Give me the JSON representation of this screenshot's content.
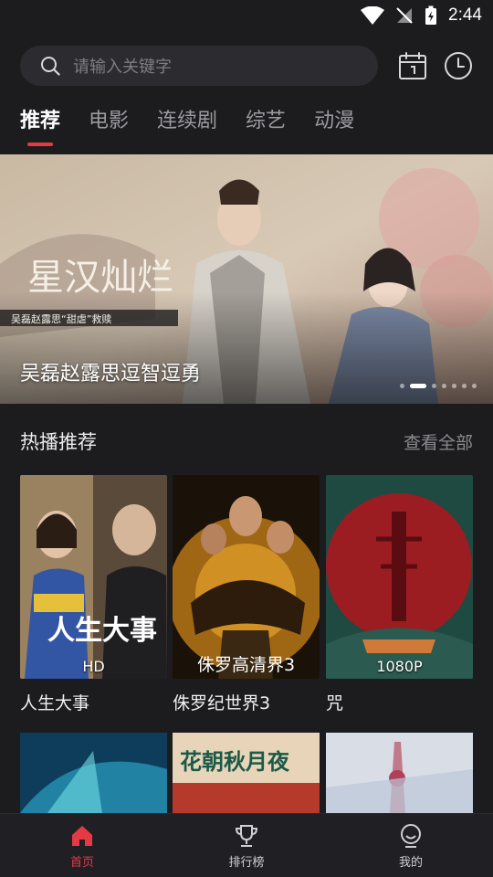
{
  "status": {
    "time": "2:44"
  },
  "search": {
    "placeholder": "请输入关键字"
  },
  "tabs": [
    {
      "label": "推荐"
    },
    {
      "label": "电影"
    },
    {
      "label": "连续剧"
    },
    {
      "label": "综艺"
    },
    {
      "label": "动漫"
    }
  ],
  "banner": {
    "title_art": "星汉灿烂",
    "subtitle_art": "吴磊赵露思“甜虐”救赎",
    "caption": "吴磊赵露思逗智逗勇",
    "slide_count": 7,
    "active_slide": 1
  },
  "section": {
    "title": "热播推荐",
    "more": "查看全部"
  },
  "posters": [
    {
      "title": "人生大事",
      "badge": "HD",
      "art_text": "人生大事"
    },
    {
      "title": "侏罗纪世界3",
      "badge": "",
      "art_text": "侏罗高清界3"
    },
    {
      "title": "咒",
      "badge": "1080P",
      "art_text": ""
    }
  ],
  "row2": [
    {
      "art_text": ""
    },
    {
      "art_text": "花朝秋月夜"
    },
    {
      "art_text": ""
    }
  ],
  "nav": [
    {
      "label": "首页",
      "icon": "home-icon"
    },
    {
      "label": "排行榜",
      "icon": "trophy-icon"
    },
    {
      "label": "我的",
      "icon": "profile-icon"
    }
  ],
  "colors": {
    "accent": "#e53945",
    "background": "#1c1c1f"
  }
}
